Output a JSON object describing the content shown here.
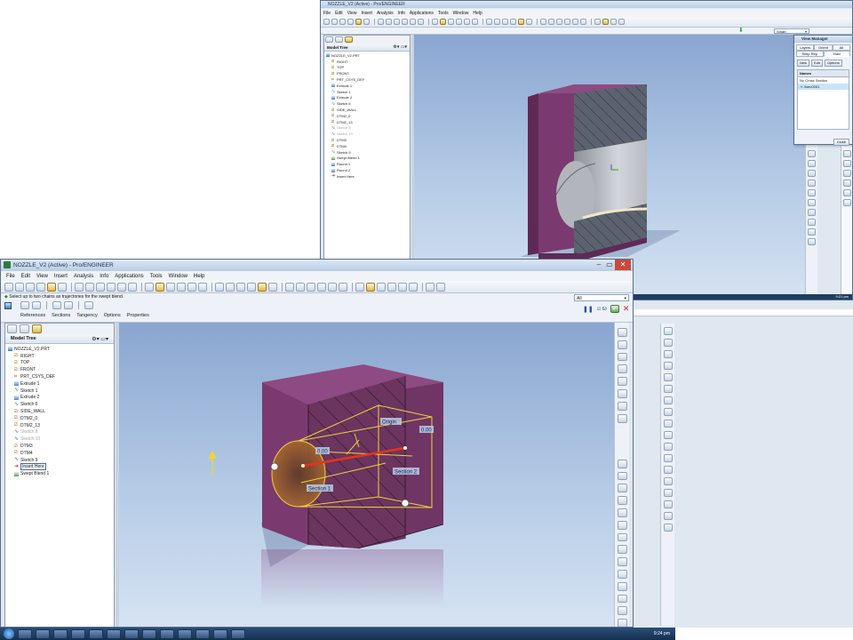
{
  "colors": {
    "part_face": "#7a3a6f",
    "part_face_top": "#8e4a82",
    "part_face_side": "#5e2a55",
    "section_fill": "#5b6370",
    "blend_yellow": "#f2d23a",
    "trajectory_red": "#e8321a",
    "titlebar_top": "#dbe7f6",
    "taskbar": "#1e3d63"
  },
  "back_window": {
    "title": "NOZZLE_V2 (Active) - Pro/ENGINEER",
    "menu": [
      "File",
      "Edit",
      "View",
      "Insert",
      "Analysis",
      "Info",
      "Applications",
      "Tools",
      "Window",
      "Help"
    ],
    "filter_value": "Smart",
    "tree_title": "Model Tree",
    "tree_items": [
      {
        "label": "NOZZLE_V2.PRT",
        "icon": "part-icon"
      },
      {
        "label": "RIGHT",
        "icon": "datum-plane-icon"
      },
      {
        "label": "TOP",
        "icon": "datum-plane-icon"
      },
      {
        "label": "FRONT",
        "icon": "datum-plane-icon"
      },
      {
        "label": "PRT_CSYS_DEF",
        "icon": "csys-icon"
      },
      {
        "label": "Extrude 1",
        "icon": "extrude-icon"
      },
      {
        "label": "Sketch 1",
        "icon": "sketch-icon"
      },
      {
        "label": "Extrude 2",
        "icon": "extrude-icon"
      },
      {
        "label": "Sketch 6",
        "icon": "sketch-icon"
      },
      {
        "label": "SIDE_WALL",
        "icon": "datum-plane-icon"
      },
      {
        "label": "DTM2_0",
        "icon": "datum-plane-icon"
      },
      {
        "label": "DTM2_13",
        "icon": "datum-plane-icon"
      },
      {
        "label": "Sketch 8",
        "icon": "sketch-icon",
        "dim": true
      },
      {
        "label": "Sketch 10",
        "icon": "sketch-icon",
        "dim": true
      },
      {
        "label": "DTM3",
        "icon": "datum-plane-icon"
      },
      {
        "label": "DTM4",
        "icon": "datum-plane-icon"
      },
      {
        "label": "Sketch 9",
        "icon": "sketch-icon"
      },
      {
        "label": "Swept Blend 1",
        "icon": "swept-blend-icon"
      },
      {
        "label": "Round 1",
        "icon": "round-icon"
      },
      {
        "label": "Round 2",
        "icon": "round-icon"
      },
      {
        "label": "Insert Here",
        "icon": "insert-here-icon"
      }
    ],
    "view_manager": {
      "title": "View Manager",
      "tabs": [
        "Layers",
        "Orient",
        "All"
      ],
      "subtabs": [
        "Simp Rep",
        "Xsec"
      ],
      "btn_new": "New",
      "btn_edit": "Edit",
      "btn_options": "Options",
      "list_header": "Names",
      "rows": [
        "No Cross Section",
        "Xsec0001"
      ],
      "close": "Close"
    }
  },
  "front_window": {
    "title": "NOZZLE_V2 (Active) - Pro/ENGINEER",
    "menu": [
      "File",
      "Edit",
      "View",
      "Insert",
      "Analysis",
      "Info",
      "Applications",
      "Tools",
      "Window",
      "Help"
    ],
    "prompt": "Select up to two chains as trajectories for the swept blend.",
    "filter_value": "All",
    "dashboard_tabs": [
      "References",
      "Sections",
      "Tangency",
      "Options",
      "Properties"
    ],
    "tree_title": "Model Tree",
    "tree_items": [
      {
        "label": "NOZZLE_V2.PRT",
        "icon": "part-icon"
      },
      {
        "label": "RIGHT",
        "icon": "datum-plane-icon"
      },
      {
        "label": "TOP",
        "icon": "datum-plane-icon"
      },
      {
        "label": "FRONT",
        "icon": "datum-plane-icon"
      },
      {
        "label": "PRT_CSYS_DEF",
        "icon": "csys-icon"
      },
      {
        "label": "Extrude 1",
        "icon": "extrude-icon"
      },
      {
        "label": "Sketch 1",
        "icon": "sketch-icon"
      },
      {
        "label": "Extrude 2",
        "icon": "extrude-icon"
      },
      {
        "label": "Sketch 6",
        "icon": "sketch-icon"
      },
      {
        "label": "SIDE_WALL",
        "icon": "datum-plane-icon"
      },
      {
        "label": "DTM2_0",
        "icon": "datum-plane-icon"
      },
      {
        "label": "DTM2_13",
        "icon": "datum-plane-icon"
      },
      {
        "label": "Sketch 8",
        "icon": "sketch-icon",
        "dim": true
      },
      {
        "label": "Sketch 10",
        "icon": "sketch-icon",
        "dim": true
      },
      {
        "label": "DTM3",
        "icon": "datum-plane-icon"
      },
      {
        "label": "DTM4",
        "icon": "datum-plane-icon"
      },
      {
        "label": "Sketch 9",
        "icon": "sketch-icon"
      },
      {
        "label": "Insert Here",
        "icon": "insert-here-icon",
        "selected": true
      },
      {
        "label": "Swept Blend 1",
        "icon": "swept-blend-icon"
      }
    ],
    "annotations": {
      "dim_left": "0.00",
      "dim_right": "0.00",
      "origin": "Origin",
      "section1": "Section 1",
      "section2": "Section 2"
    },
    "clock": "9:24 pm"
  }
}
